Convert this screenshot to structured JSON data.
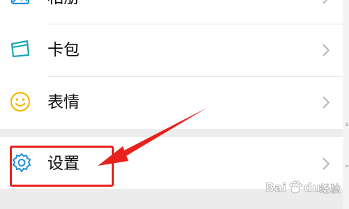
{
  "menu": {
    "items": [
      {
        "label": "相册",
        "icon": "album-icon"
      },
      {
        "label": "卡包",
        "icon": "card-wallet-icon"
      },
      {
        "label": "表情",
        "icon": "smiley-icon"
      },
      {
        "label": "设置",
        "icon": "gear-icon"
      }
    ],
    "chevron_icon": "chevron-right-icon"
  },
  "annotation": {
    "highlight_color": "#e8211d",
    "arrow_color": "#e8211d"
  },
  "watermark": {
    "text": "Baidu 经验"
  },
  "colors": {
    "background": "#ededed",
    "row_background": "#ffffff",
    "icon_blue": "#1e8fd6",
    "icon_teal": "#16a6b6",
    "icon_yellow": "#f5b800"
  }
}
